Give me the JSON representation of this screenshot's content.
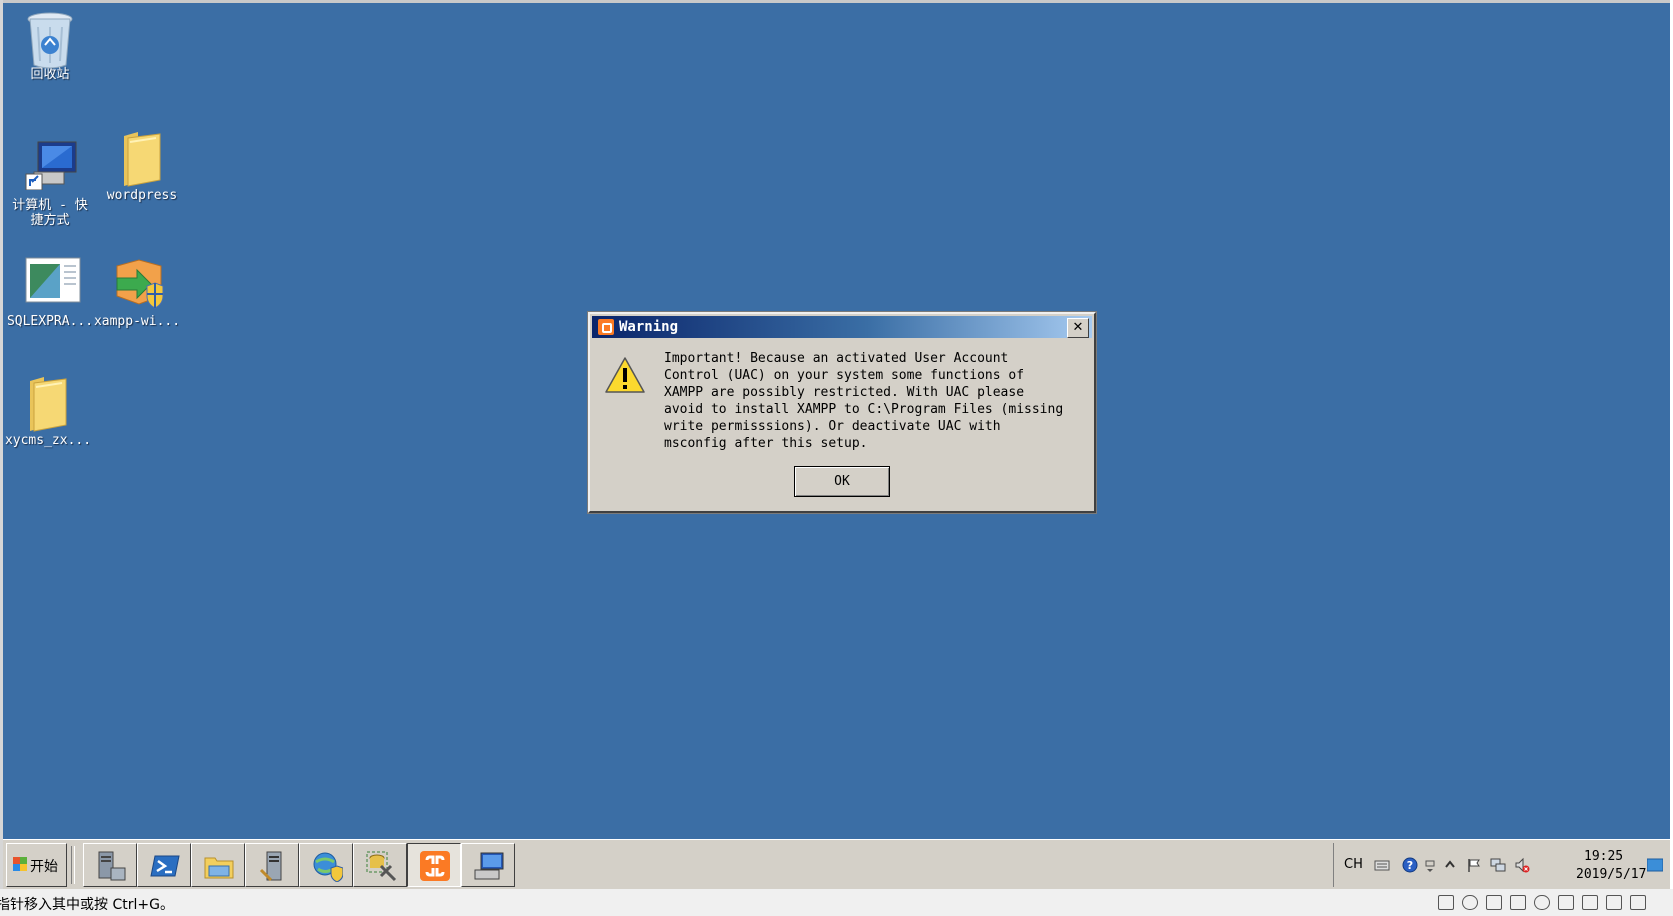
{
  "desktop": {
    "background_color": "#3b6ea5",
    "icons": [
      {
        "label": "回收站",
        "icon": "recycle-bin-icon"
      },
      {
        "label": "计算机 - 快\n捷方式",
        "icon": "computer-shortcut-icon"
      },
      {
        "label": "wordpress",
        "icon": "folder-icon"
      },
      {
        "label": "SQLEXPRA...",
        "icon": "sql-installer-icon"
      },
      {
        "label": "xampp-wi...",
        "icon": "xampp-installer-icon"
      },
      {
        "label": "xycms_zx...",
        "icon": "folder-icon"
      }
    ]
  },
  "dialog": {
    "title": "Warning",
    "message": "Important! Because an activated User Account\nControl (UAC) on your system some functions of\nXAMPP are possibly restricted. With UAC please\navoid to install XAMPP to C:\\Program Files (missing\nwrite permisssions). Or deactivate UAC with\nmsconfig after this setup.",
    "ok_label": "OK",
    "close_label": "✕"
  },
  "taskbar": {
    "start_label": "开始",
    "apps": [
      {
        "icon": "server-manager-icon"
      },
      {
        "icon": "powershell-icon"
      },
      {
        "icon": "explorer-icon"
      },
      {
        "icon": "server-tools-icon"
      },
      {
        "icon": "internet-explorer-icon"
      },
      {
        "icon": "database-tools-icon"
      },
      {
        "icon": "xampp-icon",
        "active": true
      },
      {
        "icon": "remote-desktop-icon"
      }
    ],
    "tray": {
      "language": "CH",
      "time": "19:25",
      "date": "2019/5/17"
    }
  },
  "statusbar": {
    "text": "指针移入其中或按 Ctrl+G。"
  }
}
